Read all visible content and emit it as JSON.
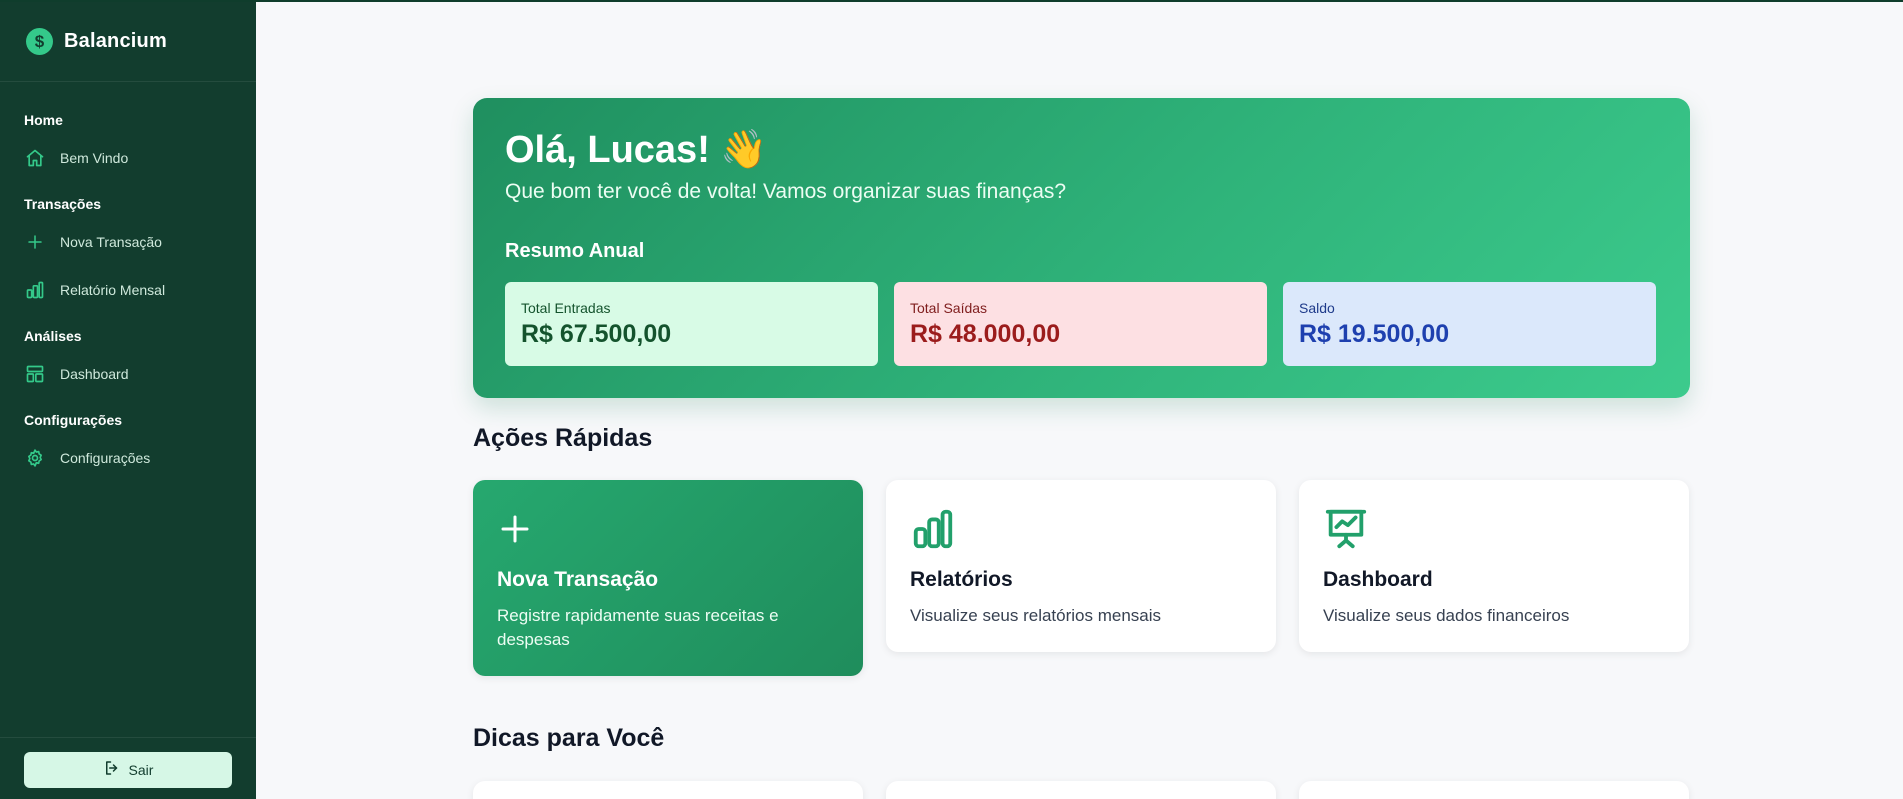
{
  "app": {
    "name": "Balancium"
  },
  "sidebar": {
    "sections": [
      {
        "title": "Home",
        "items": [
          {
            "label": "Bem Vindo",
            "icon": "home-icon"
          }
        ]
      },
      {
        "title": "Transações",
        "items": [
          {
            "label": "Nova Transação",
            "icon": "plus-icon"
          },
          {
            "label": "Relatório Mensal",
            "icon": "bar-chart-icon"
          }
        ]
      },
      {
        "title": "Análises",
        "items": [
          {
            "label": "Dashboard",
            "icon": "layout-icon"
          }
        ]
      },
      {
        "title": "Configurações",
        "items": [
          {
            "label": "Configurações",
            "icon": "gear-icon"
          }
        ]
      }
    ],
    "logout_label": "Sair"
  },
  "hero": {
    "greeting": "Olá, Lucas! 👋",
    "subtitle": "Que bom ter você de volta! Vamos organizar suas finanças?",
    "summary_title": "Resumo Anual",
    "stats": {
      "income": {
        "label": "Total Entradas",
        "value": "R$ 67.500,00"
      },
      "expenses": {
        "label": "Total Saídas",
        "value": "R$ 48.000,00"
      },
      "balance": {
        "label": "Saldo",
        "value": "R$ 19.500,00"
      }
    }
  },
  "quick_actions": {
    "title": "Ações Rápidas",
    "cards": [
      {
        "title": "Nova Transação",
        "description": "Registre rapidamente suas receitas e despesas",
        "icon": "plus-icon"
      },
      {
        "title": "Relatórios",
        "description": "Visualize seus relatórios mensais",
        "icon": "bar-chart-icon"
      },
      {
        "title": "Dashboard",
        "description": "Visualize seus dados financeiros",
        "icon": "presentation-chart-icon"
      }
    ]
  },
  "tips": {
    "title": "Dicas para Você"
  },
  "colors": {
    "sidebar_bg": "#123d2e",
    "accent": "#34c98a",
    "hero_start": "#1f8f5f",
    "hero_end": "#3ccb8d"
  }
}
